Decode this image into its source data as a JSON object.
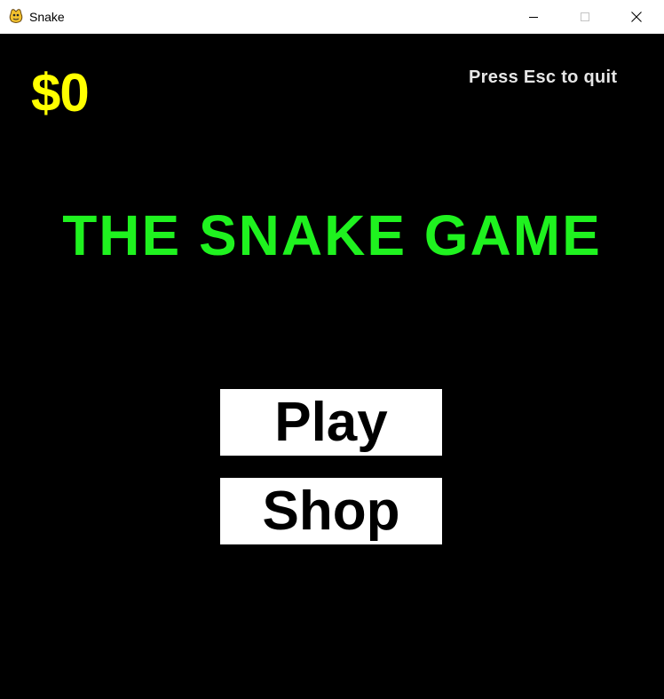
{
  "window": {
    "title": "Snake",
    "icon": "pygame-snake-icon",
    "controls": {
      "minimize": "minimize-icon",
      "maximize": "maximize-icon",
      "close": "close-icon"
    }
  },
  "hud": {
    "money": "$0",
    "quit_hint": "Press Esc to quit"
  },
  "menu": {
    "title": "THE SNAKE GAME",
    "play_label": "Play",
    "shop_label": "Shop"
  },
  "colors": {
    "background": "#000000",
    "money": "#ffff00",
    "title": "#1ff21f",
    "hint": "#e6e6e6",
    "button_bg": "#ffffff",
    "button_text": "#000000"
  }
}
